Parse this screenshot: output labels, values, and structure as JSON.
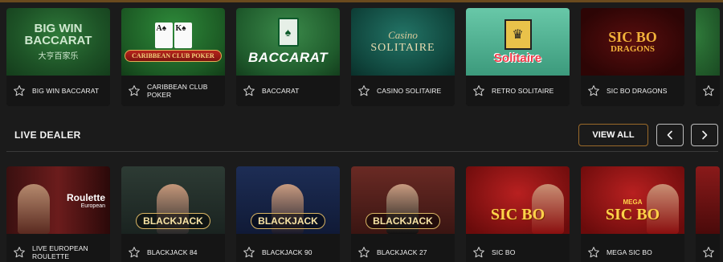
{
  "top_row": [
    {
      "title": "BIG WIN BACCARAT",
      "art_line1": "BIG WIN",
      "art_line2": "BACCARAT",
      "art_line3": "大亨百家乐"
    },
    {
      "title": "CARIBBEAN CLUB POKER",
      "art_banner": "CARIBBEAN CLUB POKER",
      "art_cards": [
        "A♠",
        "K♠"
      ]
    },
    {
      "title": "BACCARAT",
      "art_word": "BACCARAT"
    },
    {
      "title": "CASINO SOLITAIRE",
      "art_line1": "Casino",
      "art_line2": "SOLITAIRE"
    },
    {
      "title": "RETRO SOLITAIRE",
      "art_word": "Solitaire"
    },
    {
      "title": "SIC BO DRAGONS",
      "art_line1": "SIC BO",
      "art_line2": "DRAGONS"
    }
  ],
  "section": {
    "title": "LIVE DEALER",
    "view_all_label": "VIEW ALL",
    "prev_icon": "chevron-left-icon",
    "next_icon": "chevron-right-icon"
  },
  "live_row": [
    {
      "title": "LIVE EUROPEAN ROULETTE",
      "art_logo": "Roulette",
      "art_sub": "European"
    },
    {
      "title": "BLACKJACK 84",
      "art_word": "BLACKJACK"
    },
    {
      "title": "BLACKJACK 90",
      "art_word": "BLACKJACK"
    },
    {
      "title": "BLACKJACK 27",
      "art_word": "BLACKJACK"
    },
    {
      "title": "SIC BO",
      "art_word": "SIC BO"
    },
    {
      "title": "MEGA SIC BO",
      "art_mega": "MEGA",
      "art_word": "SIC BO"
    }
  ],
  "colors": {
    "background": "#1b1b1b",
    "accent": "#9a6a2a",
    "card": "#141414"
  },
  "icons": {
    "favorite": "star-outline-icon"
  }
}
